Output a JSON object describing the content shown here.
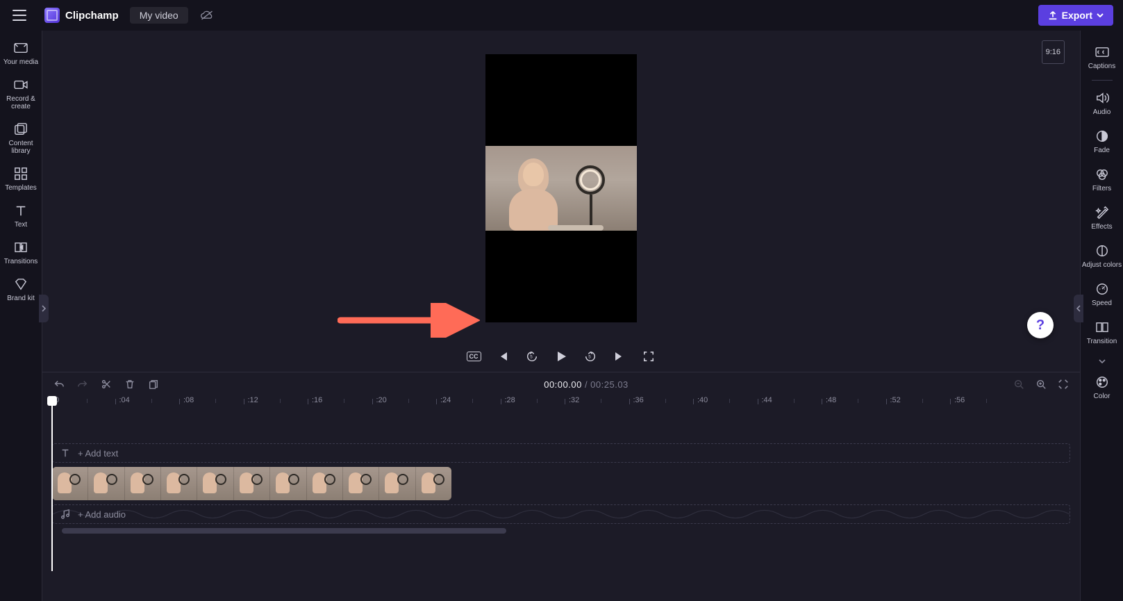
{
  "header": {
    "app_name": "Clipchamp",
    "project_name": "My video",
    "export_label": "Export"
  },
  "left_rail": {
    "items": [
      {
        "id": "your-media",
        "label": "Your media"
      },
      {
        "id": "record-create",
        "label": "Record & create"
      },
      {
        "id": "content-library",
        "label": "Content library"
      },
      {
        "id": "templates",
        "label": "Templates"
      },
      {
        "id": "text",
        "label": "Text"
      },
      {
        "id": "transitions",
        "label": "Transitions"
      },
      {
        "id": "brand-kit",
        "label": "Brand kit"
      }
    ]
  },
  "preview": {
    "aspect_badge": "9:16"
  },
  "player": {
    "current_time": "00:00.00",
    "separator": " / ",
    "total_time": "00:25.03"
  },
  "ruler": {
    "ticks": [
      "0",
      ":04",
      ":08",
      ":12",
      ":16",
      ":20",
      ":24",
      ":28",
      ":32",
      ":36",
      ":40",
      ":44",
      ":48",
      ":52",
      ":56"
    ]
  },
  "tracks": {
    "text_placeholder": "+ Add text",
    "audio_placeholder": "+ Add audio"
  },
  "right_rail": {
    "items": [
      {
        "id": "captions",
        "label": "Captions"
      },
      {
        "id": "audio",
        "label": "Audio"
      },
      {
        "id": "fade",
        "label": "Fade"
      },
      {
        "id": "filters",
        "label": "Filters"
      },
      {
        "id": "effects",
        "label": "Effects"
      },
      {
        "id": "adjust-colors",
        "label": "Adjust colors"
      },
      {
        "id": "speed",
        "label": "Speed"
      },
      {
        "id": "transition",
        "label": "Transition"
      },
      {
        "id": "color",
        "label": "Color"
      }
    ]
  }
}
